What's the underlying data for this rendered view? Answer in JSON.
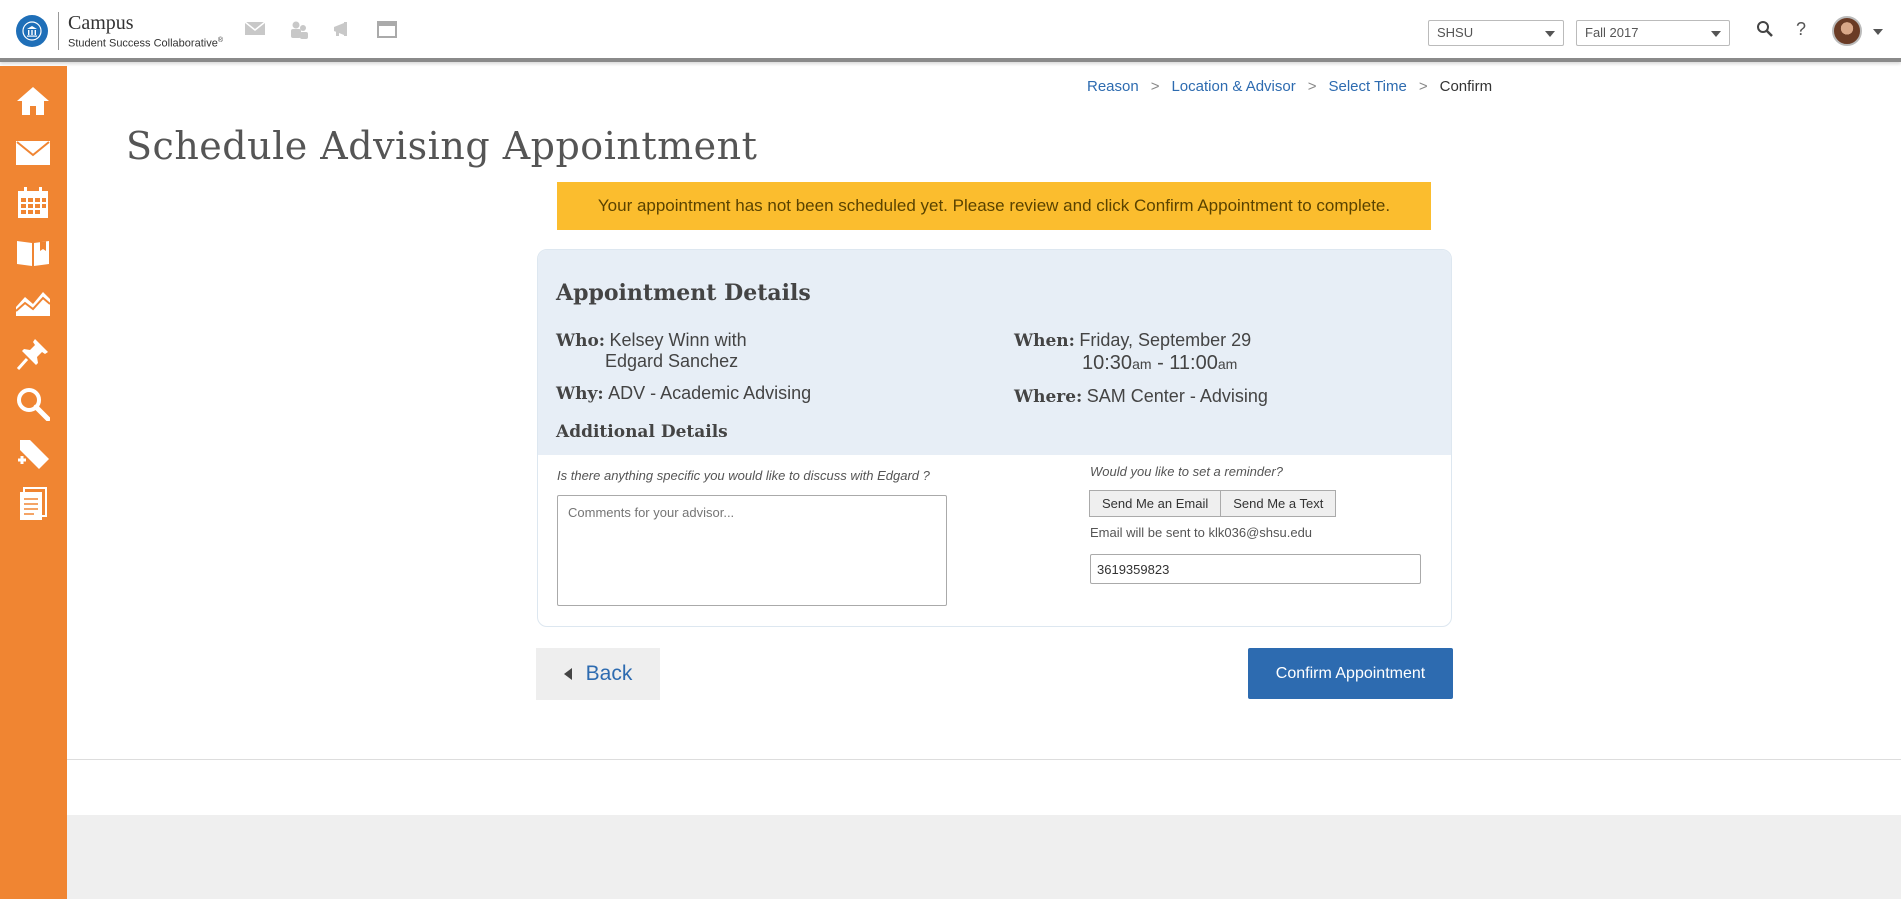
{
  "header": {
    "logo_title": "Campus",
    "logo_subtitle": "Student Success Collaborative",
    "logo_mark": "®",
    "institution_select": "SHSU",
    "term_select": "Fall 2017",
    "help_label": "?",
    "top_icons": [
      "mail-icon",
      "people-icon",
      "megaphone-icon",
      "window-icon"
    ]
  },
  "sidebar": {
    "color": "#f08532",
    "items": [
      "home-icon",
      "mail-icon",
      "calendar-icon",
      "book-icon",
      "chart-icon",
      "pin-icon",
      "search-icon",
      "tag-add-icon",
      "document-icon"
    ]
  },
  "breadcrumb": {
    "items": [
      "Reason",
      "Location & Advisor",
      "Select Time"
    ],
    "current": "Confirm",
    "separator": ">"
  },
  "page_title": "Schedule Advising Appointment",
  "alert": "Your appointment has not been scheduled yet. Please review and click Confirm Appointment to complete.",
  "details": {
    "heading": "Appointment Details",
    "who_label": "Who:",
    "who_line1": "Kelsey Winn with",
    "who_line2": "Edgard Sanchez",
    "why_label": "Why:",
    "why_value": "ADV - Academic Advising",
    "when_label": "When:",
    "when_date": "Friday, September 29",
    "time_start": "10:30",
    "time_start_ampm": "am",
    "time_sep": " - ",
    "time_end": "11:00",
    "time_end_ampm": "am",
    "where_label": "Where:",
    "where_value": "SAM Center - Advising",
    "additional_heading": "Additional Details"
  },
  "form": {
    "discuss_question": "Is there anything specific you would like to discuss with Edgard ?",
    "comments_placeholder": "Comments for your advisor...",
    "reminder_question": "Would you like to set a reminder?",
    "email_button": "Send Me an Email",
    "text_button": "Send Me a Text",
    "email_note": "Email will be sent to klk036@shsu.edu",
    "phone_value": "3619359823"
  },
  "actions": {
    "back_label": "Back",
    "confirm_label": "Confirm Appointment"
  },
  "colors": {
    "accent_blue": "#2d6bb0",
    "alert_yellow": "#fbbd2e",
    "sidebar_orange": "#f08532",
    "card_bg": "#e7eef6"
  }
}
